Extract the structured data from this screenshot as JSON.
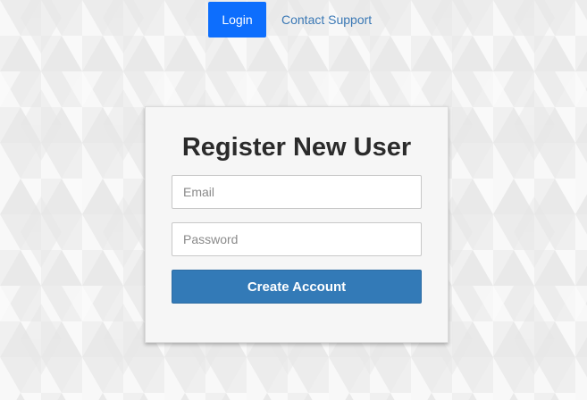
{
  "nav": {
    "login_label": "Login",
    "contact_label": "Contact Support",
    "login_color": "#0d6efd",
    "contact_color": "#3a78b5"
  },
  "register_form": {
    "title": "Register New User",
    "email": {
      "placeholder": "Email",
      "value": ""
    },
    "password": {
      "placeholder": "Password",
      "value": ""
    },
    "submit_label": "Create Account",
    "submit_color": "#337ab7"
  },
  "background": {
    "pattern": "triangle-mosaic",
    "base_color": "#f4f4f4"
  }
}
